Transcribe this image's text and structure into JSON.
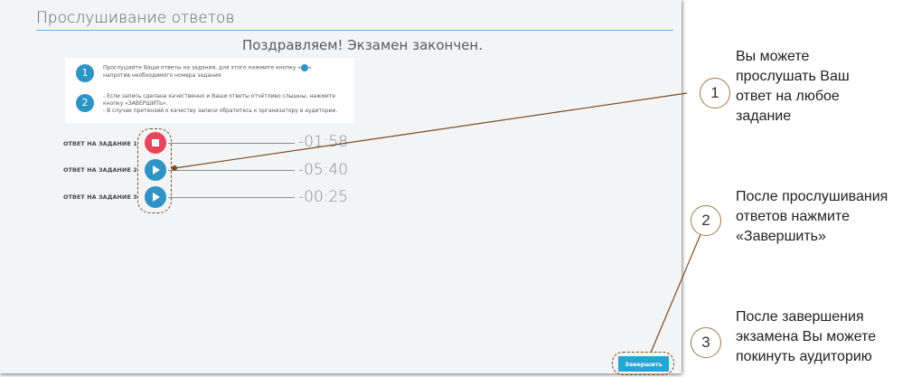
{
  "page_title": "Прослушивание ответов",
  "congrats": "Поздравляем! Экзамен закончен.",
  "instructions": [
    {
      "num": "1",
      "line1_before": "Прослушайте Ваши ответы на задания, для этого нажмите кнопку «",
      "line1_after": "»",
      "line2": "напротив необходимого номера задания"
    },
    {
      "num": "2",
      "line1": "- Если запись сделана качественно и Ваши ответы отчётливо слышны, нажмите",
      "line2": "кнопку «ЗАВЕРШИТЬ».",
      "line3": "- В случае претензий к качеству записи обратитесь к организатору в аудитории."
    }
  ],
  "answers": [
    {
      "label": "ОТВЕТ НА ЗАДАНИЕ 1",
      "time": "-01:58",
      "state": "stop"
    },
    {
      "label": "ОТВЕТ НА ЗАДАНИЕ 2",
      "time": "-05:40",
      "state": "play"
    },
    {
      "label": "ОТВЕТ НА ЗАДАНИЕ 3",
      "time": "-00:25",
      "state": "play"
    }
  ],
  "finish_button": "Завершить",
  "callouts": [
    {
      "num": "1",
      "lines": [
        "Вы можете",
        "прослушать Ваш",
        "ответ на любое",
        "задание"
      ]
    },
    {
      "num": "2",
      "lines": [
        "После прослушивания",
        "ответов нажмите",
        "«Завершить»"
      ]
    },
    {
      "num": "3",
      "lines": [
        "После завершения",
        "экзамена Вы можете",
        "покинуть аудиторию"
      ]
    }
  ],
  "colors": {
    "accent": "#2f93c6",
    "stop": "#e9455a",
    "finish": "#27a4d3",
    "leader": "#7a4a1f"
  },
  "icons": {
    "stop": "stop-icon",
    "play": "play-icon"
  }
}
